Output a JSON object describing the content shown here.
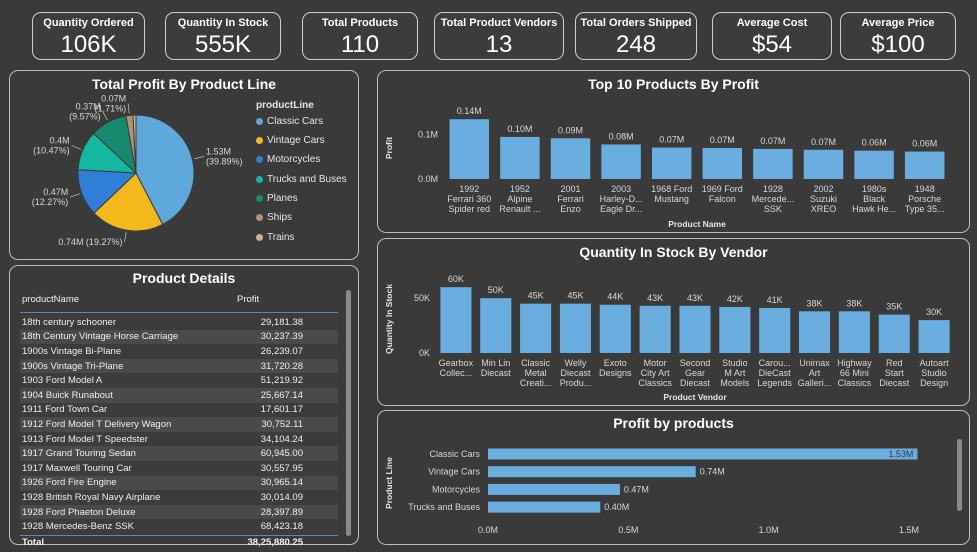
{
  "kpis": [
    {
      "label": "Quantity Ordered",
      "value": "106K"
    },
    {
      "label": "Quantity In Stock",
      "value": "555K"
    },
    {
      "label": "Total Products",
      "value": "110"
    },
    {
      "label": "Total Product Vendors",
      "value": "13"
    },
    {
      "label": "Total Orders Shipped",
      "value": "248"
    },
    {
      "label": "Average Cost",
      "value": "$54"
    },
    {
      "label": "Average Price",
      "value": "$100"
    }
  ],
  "pie": {
    "title": "Total Profit By Product Line",
    "legend_title": "productLine",
    "items": [
      {
        "label": "Classic Cars",
        "color": "#5fa8dc"
      },
      {
        "label": "Vintage Cars",
        "color": "#f2b81c"
      },
      {
        "label": "Motorcycles",
        "color": "#2f7ed8"
      },
      {
        "label": "Trucks and Buses",
        "color": "#14b8a0"
      },
      {
        "label": "Planes",
        "color": "#168a6e"
      },
      {
        "label": "Ships",
        "color": "#b39273"
      },
      {
        "label": "Trains",
        "color": "#c6b48a"
      }
    ]
  },
  "table": {
    "title": "Product Details",
    "col1": "productName",
    "col2": "Profit",
    "rows": [
      [
        "18th century schooner",
        "29,181.38"
      ],
      [
        "18th Century Vintage Horse Carriage",
        "30,237.39"
      ],
      [
        "1900s Vintage Bi-Plane",
        "26,239.07"
      ],
      [
        "1900s Vintage Tri-Plane",
        "31,720.28"
      ],
      [
        "1903 Ford Model A",
        "51,219.92"
      ],
      [
        "1904 Buick Runabout",
        "25,667.14"
      ],
      [
        "1911 Ford Town Car",
        "17,601.17"
      ],
      [
        "1912 Ford Model T Delivery Wagon",
        "30,752.11"
      ],
      [
        "1913 Ford Model T Speedster",
        "34,104.24"
      ],
      [
        "1917 Grand Touring Sedan",
        "60,945.00"
      ],
      [
        "1917 Maxwell Touring Car",
        "30,557.95"
      ],
      [
        "1926 Ford Fire Engine",
        "30,965.14"
      ],
      [
        "1928 British Royal Navy Airplane",
        "30,014.09"
      ],
      [
        "1928 Ford Phaeton Deluxe",
        "28,397.89"
      ],
      [
        "1928 Mercedes-Benz SSK",
        "68,423.18"
      ]
    ],
    "total_label": "Total",
    "total_value": "38,25,880.25"
  },
  "chart_data": [
    {
      "type": "pie",
      "title": "Total Profit By Product Line",
      "categories": [
        "Classic Cars",
        "Vintage Cars",
        "Motorcycles",
        "Trucks and Buses",
        "Planes",
        "Ships",
        "Trains"
      ],
      "values": [
        1.53,
        0.74,
        0.47,
        0.4,
        0.37,
        0.07,
        0.03
      ],
      "labels": [
        [
          "1.53M",
          "(39.89%)"
        ],
        [
          "0.74M (19.27%)"
        ],
        [
          "0.47M",
          "(12.27%)"
        ],
        [
          "0.4M",
          "(10.47%)"
        ],
        [
          "0.37M",
          "(9.57%)"
        ],
        [
          "0.07M",
          "(1.71%)"
        ],
        []
      ],
      "legend_title": "productLine",
      "legend_position": "right"
    },
    {
      "type": "bar",
      "title": "Top 10 Products By Profit",
      "xlabel": "Product Name",
      "ylabel": "Profit",
      "categories": [
        [
          "1992",
          "Ferrari 360",
          "Spider red"
        ],
        [
          "1952",
          "Alpine",
          "Renault ..."
        ],
        [
          "2001",
          "Ferrari",
          "Enzo"
        ],
        [
          "2003",
          "Harley-D...",
          "Eagle Dr..."
        ],
        [
          "1968 Ford",
          "Mustang"
        ],
        [
          "1969 Ford",
          "Falcon"
        ],
        [
          "1928",
          "Mercede...",
          "SSK"
        ],
        [
          "2002",
          "Suzuki",
          "XREO"
        ],
        [
          "1980s",
          "Black",
          "Hawk He..."
        ],
        [
          "1948",
          "Porsche",
          "Type 35..."
        ]
      ],
      "values": [
        0.135,
        0.095,
        0.092,
        0.078,
        0.071,
        0.07,
        0.068,
        0.066,
        0.064,
        0.062
      ],
      "data_labels": [
        "0.14M",
        "0.10M",
        "0.09M",
        "0.08M",
        "0.07M",
        "0.07M",
        "0.07M",
        "0.07M",
        "0.06M",
        "0.06M"
      ],
      "yticks": [
        {
          "v": 0,
          "t": "0.0M"
        },
        {
          "v": 0.1,
          "t": "0.1M"
        }
      ],
      "ylim": [
        0,
        0.14
      ],
      "color": "#6aaee0"
    },
    {
      "type": "bar",
      "title": "Quantity In Stock By Vendor",
      "xlabel": "Product Vendor",
      "ylabel": "Quantity In Stock",
      "categories": [
        [
          "Gearbox",
          "Collec..."
        ],
        [
          "Min Lin",
          "Diecast"
        ],
        [
          "Classic",
          "Metal",
          "Creati..."
        ],
        [
          "Welly",
          "Diecast",
          "Produ..."
        ],
        [
          "Exoto",
          "Designs"
        ],
        [
          "Motor",
          "City Art",
          "Classics"
        ],
        [
          "Second",
          "Gear",
          "Diecast"
        ],
        [
          "Studio",
          "M Art",
          "Models"
        ],
        [
          "Carou...",
          "DieCast",
          "Legends"
        ],
        [
          "Unimax",
          "Art",
          "Galleri..."
        ],
        [
          "Highway",
          "66 Mini",
          "Classics"
        ],
        [
          "Red",
          "Start",
          "Diecast"
        ],
        [
          "Autoart",
          "Studio",
          "Design"
        ]
      ],
      "values": [
        60,
        50,
        45,
        45,
        44,
        43,
        43,
        42,
        41,
        38,
        38,
        35,
        30
      ],
      "data_labels": [
        "60K",
        "50K",
        "45K",
        "45K",
        "44K",
        "43K",
        "43K",
        "42K",
        "41K",
        "38K",
        "38K",
        "35K",
        "30K"
      ],
      "yticks": [
        {
          "v": 0,
          "t": "0K"
        },
        {
          "v": 50,
          "t": "50K"
        }
      ],
      "ylim": [
        0,
        62
      ],
      "color": "#6aaee0"
    },
    {
      "type": "bar",
      "orientation": "horizontal",
      "title": "Profit by products",
      "ylabel": "Product Line",
      "categories": [
        "Classic Cars",
        "Vintage Cars",
        "Motorcycles",
        "Trucks and Buses"
      ],
      "values": [
        1.53,
        0.74,
        0.47,
        0.4
      ],
      "data_labels": [
        "1.53M",
        "0.74M",
        "0.47M",
        "0.40M"
      ],
      "xticks": [
        {
          "v": 0,
          "t": "0.0M"
        },
        {
          "v": 0.5,
          "t": "0.5M"
        },
        {
          "v": 1.0,
          "t": "1.0M"
        },
        {
          "v": 1.5,
          "t": "1.5M"
        }
      ],
      "xlim": [
        0,
        1.5
      ],
      "color": "#6aaee0"
    }
  ]
}
